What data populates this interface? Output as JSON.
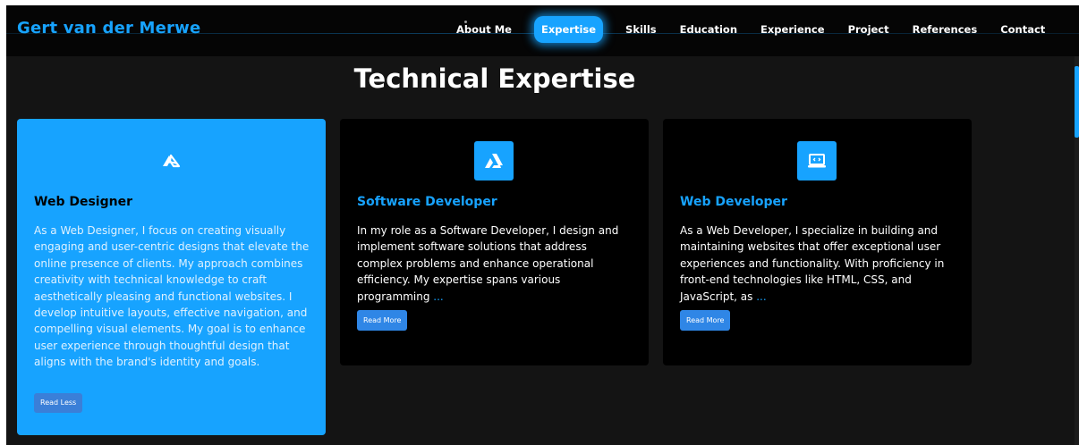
{
  "navbar": {
    "brand": "Gert van der Merwe",
    "items": [
      {
        "label": "About Me"
      },
      {
        "label": "Expertise",
        "active": true
      },
      {
        "label": "Skills"
      },
      {
        "label": "Education"
      },
      {
        "label": "Experience"
      },
      {
        "label": "Project"
      },
      {
        "label": "References"
      },
      {
        "label": "Contact"
      }
    ]
  },
  "section": {
    "title": "Technical Expertise"
  },
  "cards": [
    {
      "icon": "designer-logo-icon",
      "title": "Web Designer",
      "text": "As a Web Designer, I focus on creating visually engaging and user-centric designs that elevate the online presence of clients. My approach combines creativity with technical knowledge to craft aesthetically pleasing and functional websites. I develop intuitive layouts, effective navigation, and compelling visual elements. My goal is to enhance user experience through thoughtful design that aligns with the brand's identity and goals.",
      "ellipsis": "",
      "button": "Read Less"
    },
    {
      "icon": "software-logo-icon",
      "title": "Software Developer",
      "text": "In my role as a Software Developer, I design and implement software solutions that address complex problems and enhance operational efficiency. My expertise spans various programming",
      "ellipsis": "...",
      "button": "Read More"
    },
    {
      "icon": "laptop-code-icon",
      "title": "Web Developer",
      "text": "As a Web Developer, I specialize in building and maintaining websites that offer exceptional user experiences and functionality. With proficiency in front-end technologies like HTML, CSS, and JavaScript, as",
      "ellipsis": "...",
      "button": "Read More"
    }
  ],
  "colors": {
    "accent": "#17a3ff",
    "background": "#141414",
    "card_dark": "#000000",
    "button": "#2f86e6"
  }
}
